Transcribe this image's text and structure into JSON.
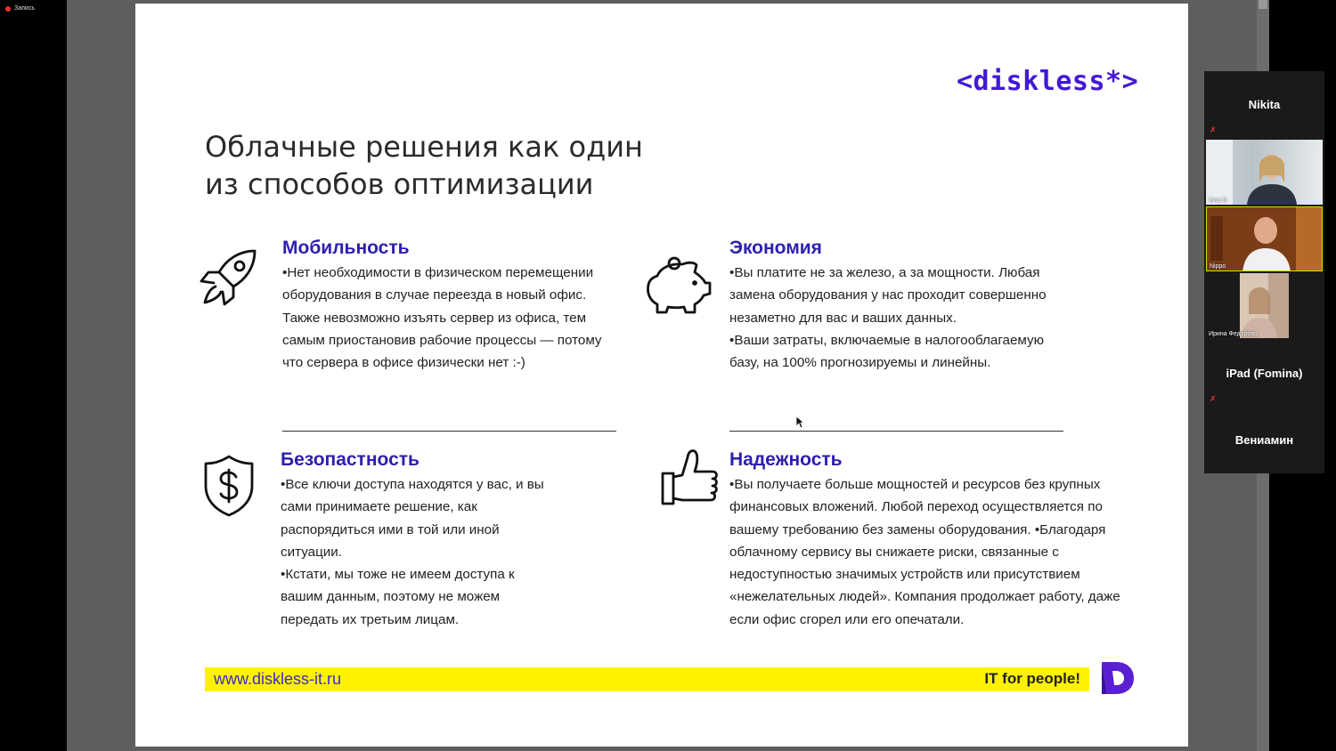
{
  "recording": {
    "label": "Запись"
  },
  "slide": {
    "logo": "<diskless*>",
    "title_line1": "Облачные решения как один",
    "title_line2": "из способов оптимизации",
    "sections": [
      {
        "heading": "Мобильность",
        "icon": "rocket-icon",
        "paragraphs": [
          "•Нет необходимости в физическом перемещении оборудования в случае переезда в новый офис. Также невозможно изъять сервер из офиса, тем самым приостановив рабочие процессы — потому что сервера в офисе физически нет :-)"
        ]
      },
      {
        "heading": "Экономия",
        "icon": "piggy-bank-icon",
        "paragraphs": [
          "•Вы платите не за железо, а за мощности. Любая замена оборудования у нас проходит совершенно незаметно для вас и ваших данных.",
          "•Ваши затраты, включаемые в налогооблагаемую базу, на 100% прогнозируемы и линейны."
        ]
      },
      {
        "heading": "Безопастность",
        "icon": "shield-dollar-icon",
        "paragraphs": [
          "•Все ключи доступа находятся у вас, и вы сами принимаете решение, как распорядиться ими в той или иной ситуации.",
          "•Кстати, мы тоже не имеем доступа к вашим данным, поэтому не можем передать их третьим лицам."
        ]
      },
      {
        "heading": "Надежность",
        "icon": "thumbs-up-icon",
        "paragraphs": [
          "•Вы получаете больше мощностей и ресурсов без крупных финансовых вложений. Любой переход осуществляется по вашему требованию без замены оборудования. •Благодаря облачному сервису вы снижаете риски, связанные с недоступностью значимых устройств или присутствием «нежелательных людей». Компания продолжает работу, даже если офис сгорел или его опечатали."
        ]
      }
    ],
    "footer": {
      "url": "www.diskless-it.ru",
      "tagline": "IT for people!"
    },
    "colors": {
      "heading": "#2d1fb0",
      "logo": "#4318d6",
      "footer_bar": "#fff200"
    }
  },
  "participants": [
    {
      "name": "Nikita",
      "type": "name",
      "muted": true
    },
    {
      "name": "Inna S",
      "type": "video",
      "muted": false
    },
    {
      "name": "Nippo",
      "type": "video",
      "muted": false
    },
    {
      "name": "Ирина Федорова",
      "type": "video",
      "muted": false
    },
    {
      "name": "iPad (Fomina)",
      "type": "name",
      "muted": true
    },
    {
      "name": "Вениамин",
      "type": "name",
      "muted": false
    }
  ]
}
